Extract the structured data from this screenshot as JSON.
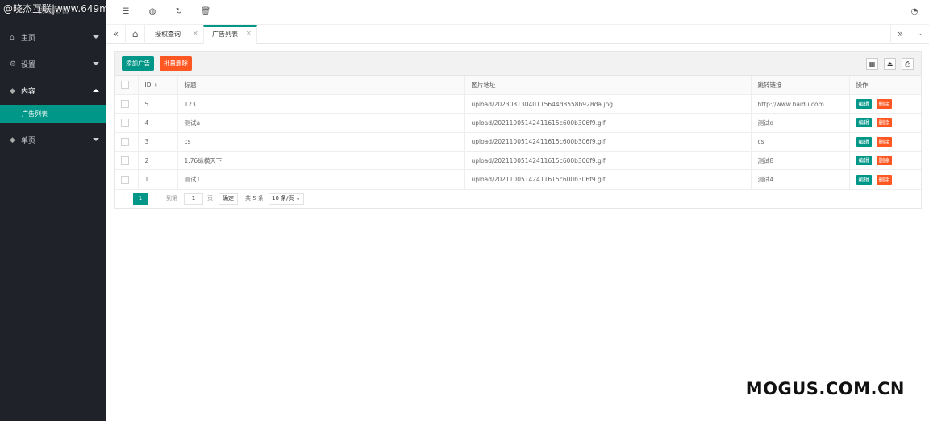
{
  "watermark_top": "@晓杰互联|www.649m",
  "logo_text": "畅跑后台",
  "sidebar": {
    "items": [
      {
        "icon": "home-icon",
        "label": "主页"
      },
      {
        "icon": "gear-icon",
        "label": "设置"
      },
      {
        "icon": "diamond-icon",
        "label": "内容"
      },
      {
        "icon": "diamond-icon",
        "label": "单页"
      }
    ],
    "sub_item": "广告列表"
  },
  "header_icons": [
    "menu-toggle-icon",
    "globe-icon",
    "refresh-icon",
    "trash-icon",
    "theme-icon"
  ],
  "tabs": [
    {
      "label": "授权查询"
    },
    {
      "label": "广告列表"
    }
  ],
  "toolbar": {
    "add_label": "添加广告",
    "batch_delete_label": "批量删除"
  },
  "table": {
    "headers": [
      "ID",
      "标题",
      "图片地址",
      "跳转链接",
      "操作"
    ],
    "rows": [
      {
        "id": "5",
        "title": "123",
        "image": "upload/20230813040115644d8558b928da.jpg",
        "link": "http://www.baidu.com"
      },
      {
        "id": "4",
        "title": "测试a",
        "image": "upload/20211005142411615c600b306f9.gif",
        "link": "测试d"
      },
      {
        "id": "3",
        "title": "cs",
        "image": "upload/20211005142411615c600b306f9.gif",
        "link": "cs"
      },
      {
        "id": "2",
        "title": "1.76纵横天下",
        "image": "upload/20211005142411615c600b306f9.gif",
        "link": "测试8"
      },
      {
        "id": "1",
        "title": "测试1",
        "image": "upload/20211005142411615c600b306f9.gif",
        "link": "测试4"
      }
    ],
    "edit_label": "编辑",
    "delete_label": "删除"
  },
  "pager": {
    "current": "1",
    "goto_label": "到第",
    "goto_value": "1",
    "page_unit": "页",
    "confirm_label": "确定",
    "total": "共 5 条",
    "per_page": "10 条/页"
  },
  "brand": "MOGUS.COM.CN",
  "colors": {
    "sidebar": "#20222a",
    "accent": "#009688",
    "danger": "#ff5722"
  }
}
